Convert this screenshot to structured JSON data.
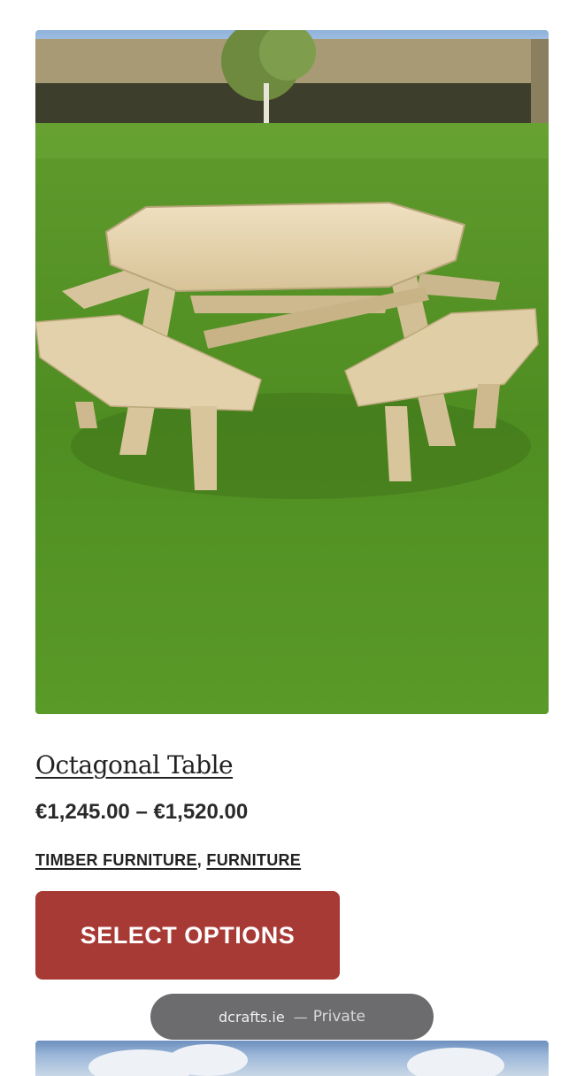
{
  "product": {
    "image_alt": "Octagonal Table",
    "title": "Octagonal Table",
    "price": "€1,245.00 – €1,520.00",
    "categories": [
      "TIMBER FURNITURE",
      "FURNITURE"
    ],
    "category_separator": ", ",
    "button_label": "SELECT OPTIONS"
  },
  "browser_bar": {
    "domain": "dcrafts.ie",
    "separator": "—",
    "mode": "Private"
  },
  "colors": {
    "button": "#a83a35",
    "text": "#222222"
  }
}
